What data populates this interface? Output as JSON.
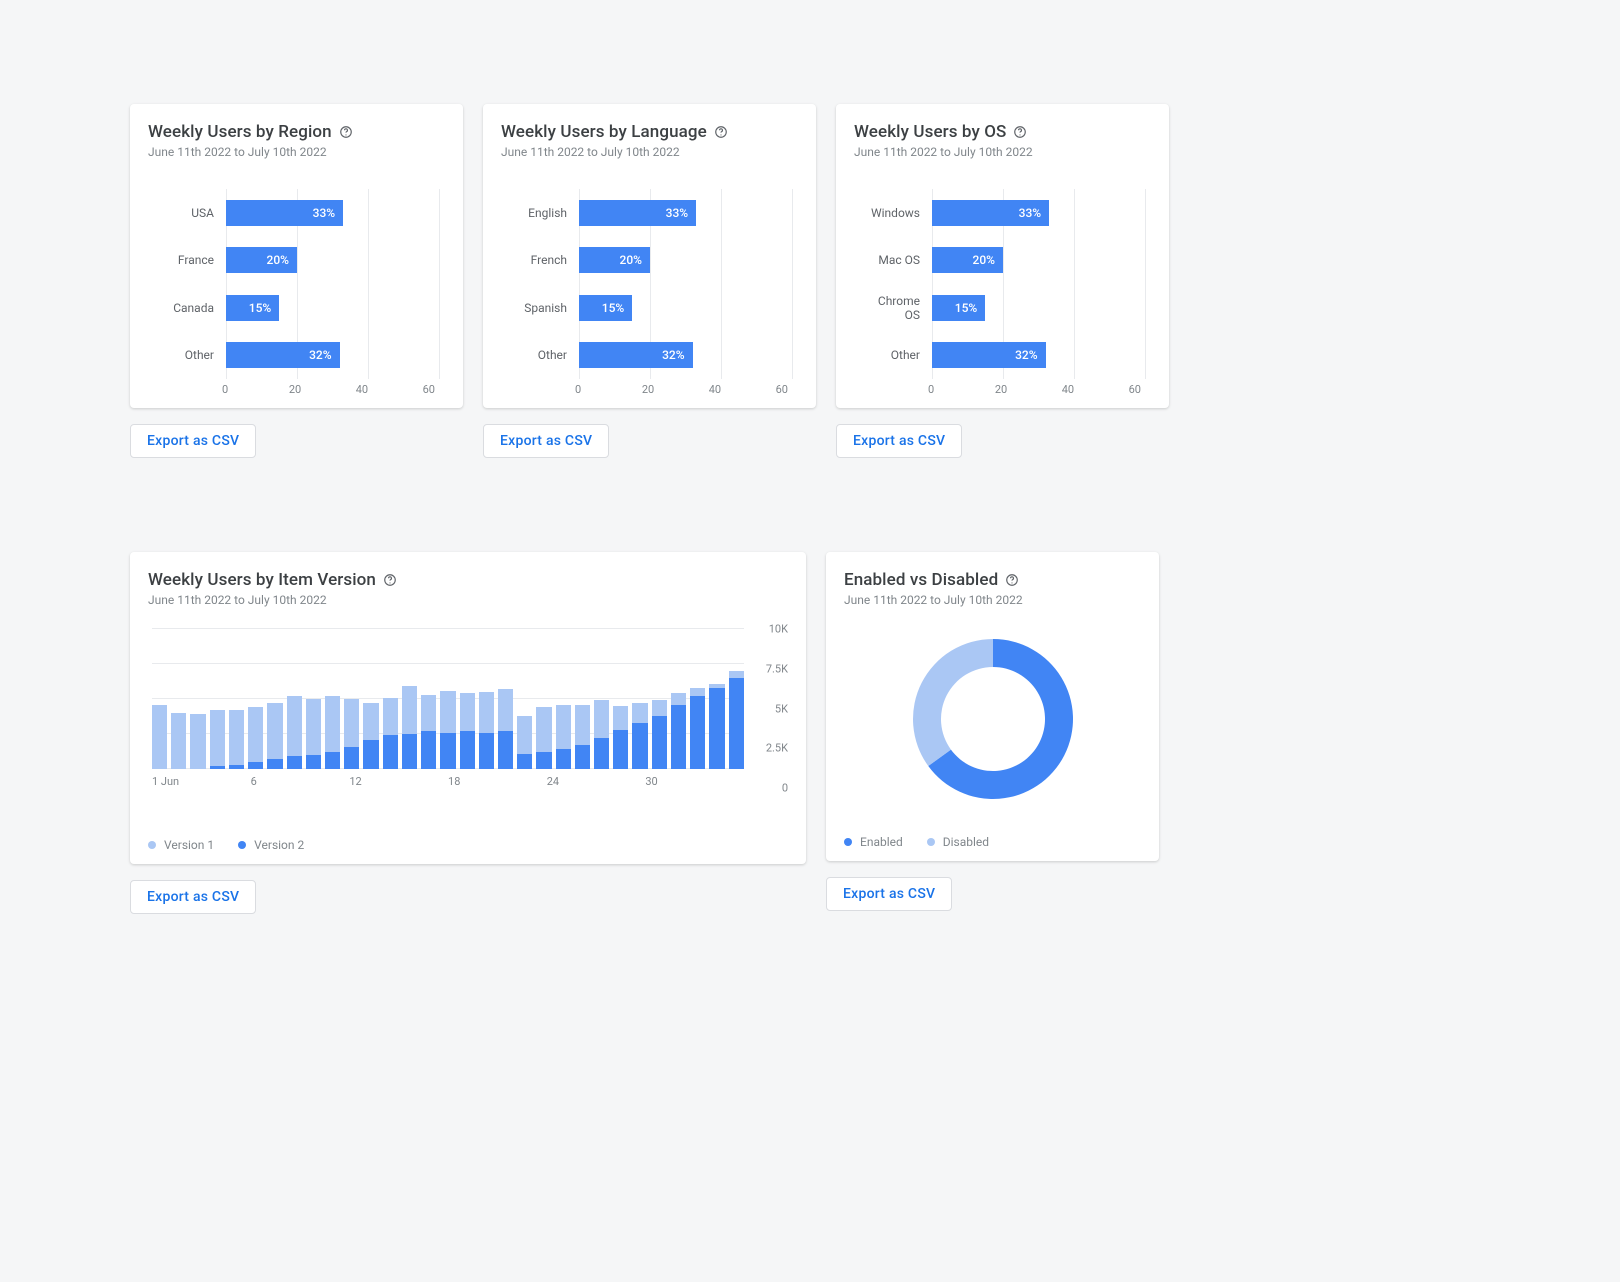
{
  "global": {
    "date_range": "June 11th 2022 to July 10th 2022",
    "export_label": "Export as CSV"
  },
  "cards": {
    "region": {
      "title": "Weekly Users by Region"
    },
    "language": {
      "title": "Weekly Users by Language"
    },
    "os": {
      "title": "Weekly Users by OS"
    },
    "version": {
      "title": "Weekly Users by Item Version"
    },
    "enabled": {
      "title": "Enabled vs Disabled"
    }
  },
  "legend": {
    "version1": "Version 1",
    "version2": "Version 2",
    "enabled": "Enabled",
    "disabled": "Disabled"
  },
  "colors": {
    "bar": "#4185f4",
    "bar_light": "#aac7f4"
  },
  "hbar_axis": {
    "ticks": [
      "0",
      "20",
      "40",
      "60"
    ],
    "max": 60
  },
  "version_yticks": [
    {
      "label": "10K",
      "v": 10000
    },
    {
      "label": "7.5K",
      "v": 7500
    },
    {
      "label": "5K",
      "v": 5000
    },
    {
      "label": "2.5K",
      "v": 2500
    },
    {
      "label": "0",
      "v": 0
    }
  ],
  "version_xticks": [
    "1 Jun",
    "6",
    "12",
    "18",
    "24",
    "30"
  ],
  "chart_data": [
    {
      "id": "region",
      "type": "bar",
      "orientation": "horizontal",
      "title": "Weekly Users by Region",
      "categories": [
        "USA",
        "France",
        "Canada",
        "Other"
      ],
      "values": [
        33,
        20,
        15,
        32
      ],
      "xlabel": "",
      "ylabel": "",
      "xlim": [
        0,
        60
      ],
      "unit": "%"
    },
    {
      "id": "language",
      "type": "bar",
      "orientation": "horizontal",
      "title": "Weekly Users by Language",
      "categories": [
        "English",
        "French",
        "Spanish",
        "Other"
      ],
      "values": [
        33,
        20,
        15,
        32
      ],
      "xlabel": "",
      "ylabel": "",
      "xlim": [
        0,
        60
      ],
      "unit": "%"
    },
    {
      "id": "os",
      "type": "bar",
      "orientation": "horizontal",
      "title": "Weekly Users by OS",
      "categories": [
        "Windows",
        "Mac OS",
        "Chrome OS",
        "Other"
      ],
      "values": [
        33,
        20,
        15,
        32
      ],
      "xlabel": "",
      "ylabel": "",
      "xlim": [
        0,
        60
      ],
      "unit": "%"
    },
    {
      "id": "version",
      "type": "bar",
      "stacked": true,
      "title": "Weekly Users by Item Version",
      "x": [
        1,
        2,
        3,
        4,
        5,
        6,
        7,
        8,
        9,
        10,
        11,
        12,
        13,
        14,
        15,
        16,
        17,
        18,
        19,
        20,
        21,
        22,
        23,
        24,
        25,
        26,
        27,
        28,
        29,
        30,
        31
      ],
      "series": [
        {
          "name": "Version 1",
          "values": [
            4600,
            4000,
            3900,
            4200,
            4200,
            4400,
            4700,
            5200,
            5000,
            5200,
            5000,
            4700,
            5100,
            5900,
            5300,
            5600,
            5400,
            5500,
            5700,
            3800,
            4400,
            4600,
            4600,
            4900,
            4500,
            4700,
            4900,
            5400,
            5800,
            6100,
            7000
          ]
        },
        {
          "name": "Version 2",
          "values": [
            0,
            0,
            0,
            200,
            300,
            500,
            700,
            900,
            1000,
            1200,
            1600,
            2100,
            2400,
            2500,
            2700,
            2600,
            2700,
            2600,
            2700,
            1100,
            1200,
            1400,
            1700,
            2200,
            2800,
            3300,
            3800,
            4600,
            5200,
            5800,
            6500
          ]
        }
      ],
      "xlabel": "",
      "ylabel": "",
      "ylim": [
        0,
        10000
      ]
    },
    {
      "id": "enabled",
      "type": "pie",
      "donut": true,
      "title": "Enabled vs Disabled",
      "categories": [
        "Enabled",
        "Disabled"
      ],
      "values": [
        65,
        35
      ]
    }
  ]
}
